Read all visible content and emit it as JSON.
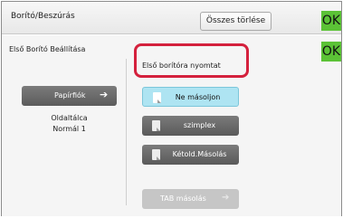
{
  "header": {
    "title": "Borító/Beszúrás",
    "clear_all_label": "Összes törlése",
    "ok_label": "OK"
  },
  "panel": {
    "title": "Első Borító Beállítása",
    "ok_label": "OK",
    "paper_tray_button": {
      "label": "Papírfiók",
      "icon": "arrow-right-icon"
    },
    "tray_info": {
      "line1": "Oldaltálca",
      "line2": "Normál 1"
    },
    "options_label": "Első borítóra nyomtat",
    "options": [
      {
        "label": "Ne másoljon",
        "selected": true,
        "icon": "blank-page-icon"
      },
      {
        "label": "szimplex",
        "selected": false,
        "icon": "simplex-page-icon"
      },
      {
        "label": "Kétold.Másolás",
        "selected": false,
        "icon": "duplex-page-icon"
      }
    ],
    "tab_copy_button": {
      "label": "TAB másolás",
      "enabled": false,
      "icon": "arrow-right-icon"
    }
  },
  "colors": {
    "ok_green": "#5bc236",
    "selected_blue": "#aee4f2",
    "highlight_red": "#d4213d",
    "button_gray": "#6a6a6a"
  }
}
